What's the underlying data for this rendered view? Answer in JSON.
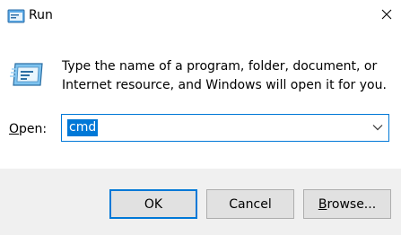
{
  "window": {
    "title": "Run",
    "app_icon": "run-dialog-icon",
    "close_icon": "close-icon"
  },
  "content": {
    "icon": "run-program-icon",
    "description": "Type the name of a program, folder, document, or Internet resource, and Windows will open it for you.",
    "open_label_accel": "O",
    "open_label_rest": "pen:",
    "open_value": "cmd",
    "dropdown_icon": "chevron-down-icon"
  },
  "buttons": {
    "ok": "OK",
    "cancel": "Cancel",
    "browse_accel": "B",
    "browse_rest": "rowse..."
  },
  "colors": {
    "accent": "#0078d7",
    "footer_bg": "#f0f0f0",
    "button_bg": "#e1e1e1"
  }
}
